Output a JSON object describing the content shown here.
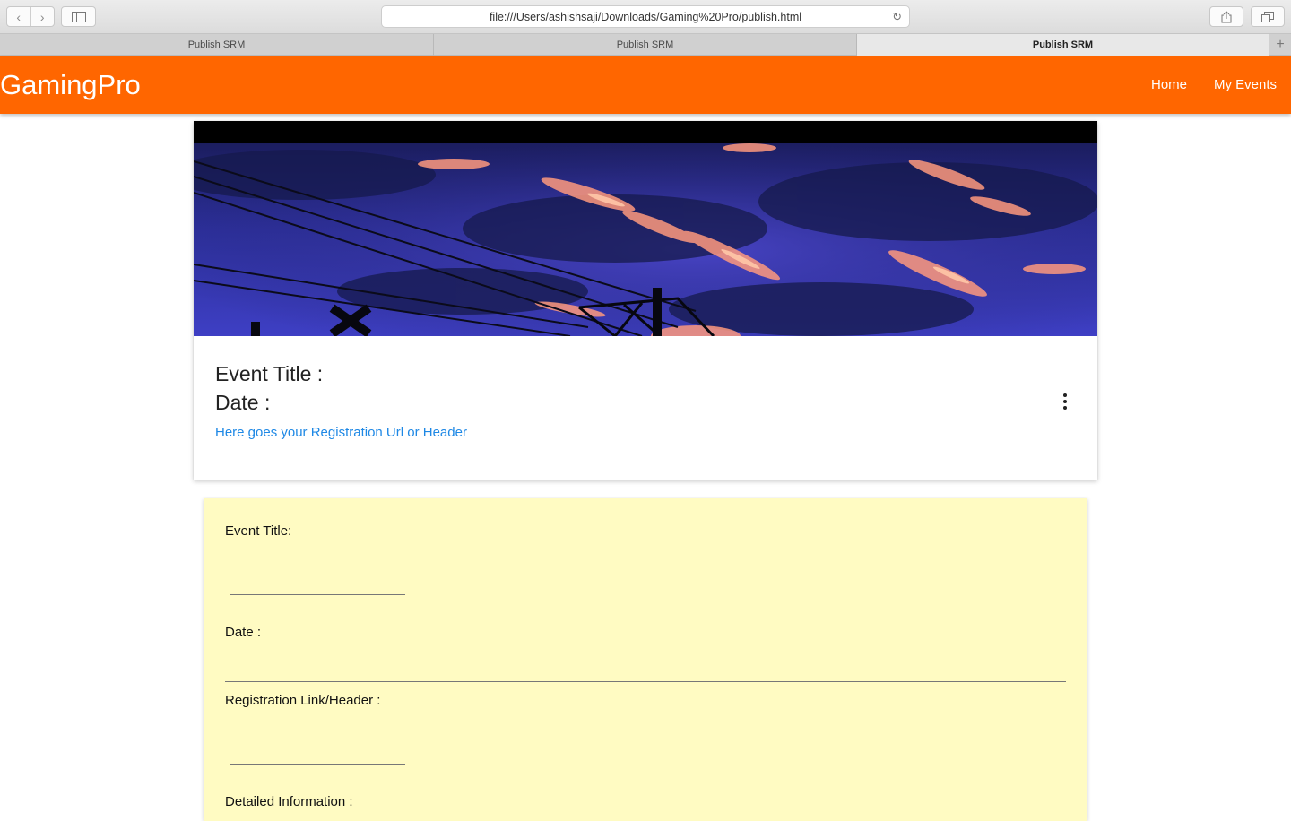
{
  "browser": {
    "url": "file:///Users/ashishsaji/Downloads/Gaming%20Pro/publish.html",
    "tabs": [
      {
        "label": "Publish SRM",
        "active": false
      },
      {
        "label": "Publish SRM",
        "active": false
      },
      {
        "label": "Publish SRM",
        "active": true
      }
    ],
    "icons": {
      "back": "chevron-left-icon",
      "forward": "chevron-right-icon",
      "sidebar": "sidebar-icon",
      "reload": "reload-icon",
      "share": "share-icon",
      "tabs": "tabs-overview-icon",
      "new_tab": "plus-icon"
    }
  },
  "header": {
    "brand": "GamingPro",
    "color": "#ff6600",
    "nav": {
      "home": "Home",
      "my_events": "My Events"
    }
  },
  "card": {
    "image": "sunset sky with power lines",
    "title_label": "Event Title :",
    "date_label": "Date :",
    "link_text": "Here goes your Registration Url or Header",
    "link_color": "#1e88e5",
    "menu_icon": "more-vert-icon"
  },
  "form": {
    "background": "#fffbc2",
    "event_title_label": "Event Title:",
    "event_title_value": "",
    "date_label": "Date :",
    "date_value": "",
    "registration_label": "Registration Link/Header :",
    "registration_value": "",
    "detailed_label": "Detailed Information :"
  }
}
